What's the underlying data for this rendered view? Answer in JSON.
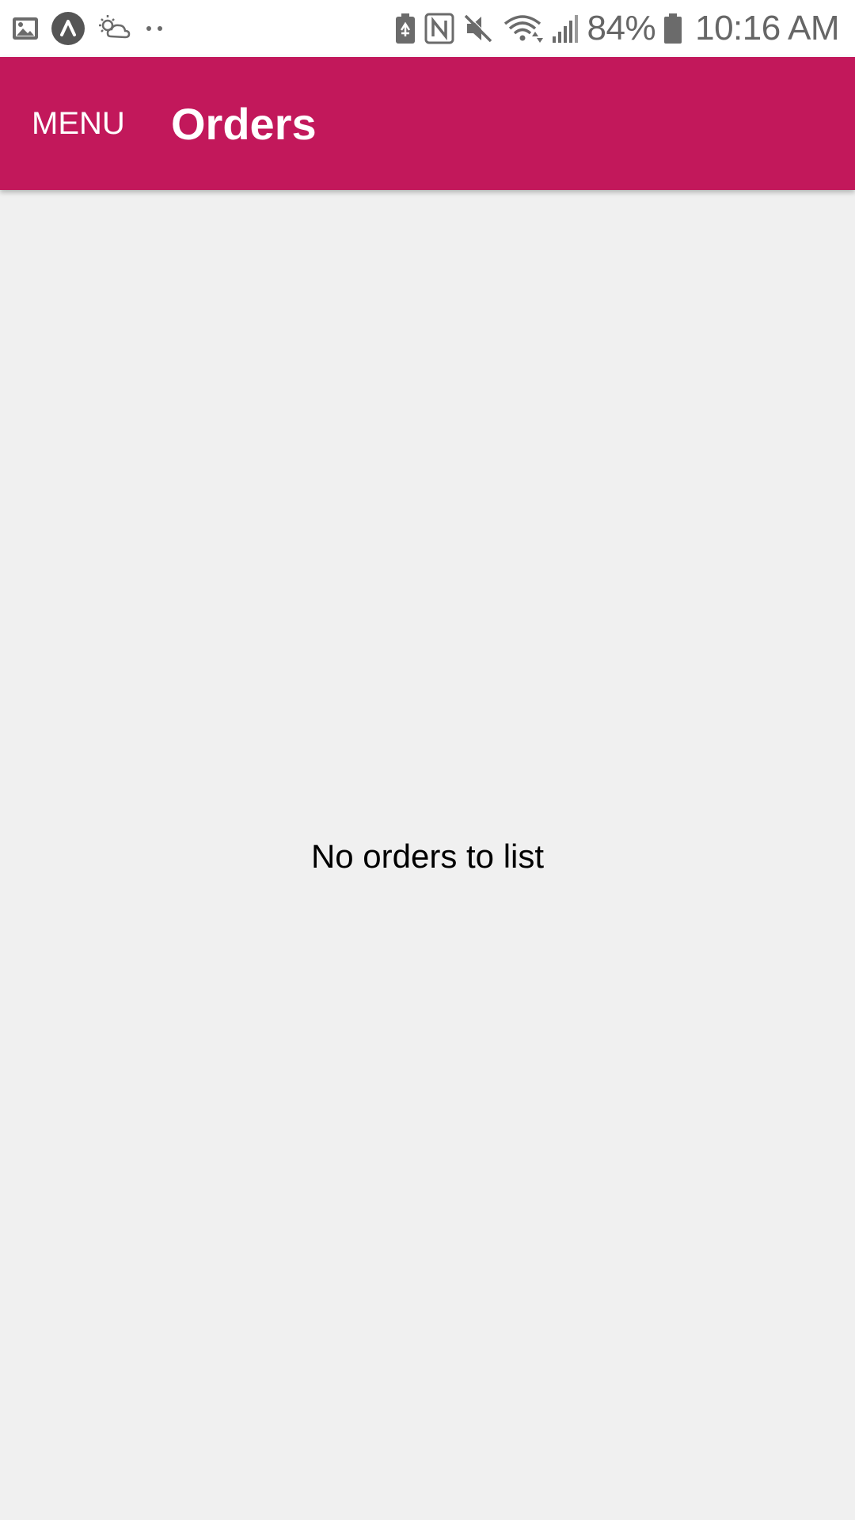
{
  "status_bar": {
    "left_icons": [
      "gallery-icon",
      "app-circle-icon",
      "weather-icon",
      "more-dots-icon"
    ],
    "right_icons": [
      "battery-saver-icon",
      "nfc-icon",
      "mute-icon",
      "wifi-icon",
      "signal-icon",
      "battery-icon"
    ],
    "battery_percent": "84%",
    "time": "10:16 AM"
  },
  "app_bar": {
    "menu_label": "MENU",
    "title": "Orders",
    "color": "#c2185b"
  },
  "main": {
    "empty_message": "No orders to list",
    "background": "#f0f0f0"
  }
}
